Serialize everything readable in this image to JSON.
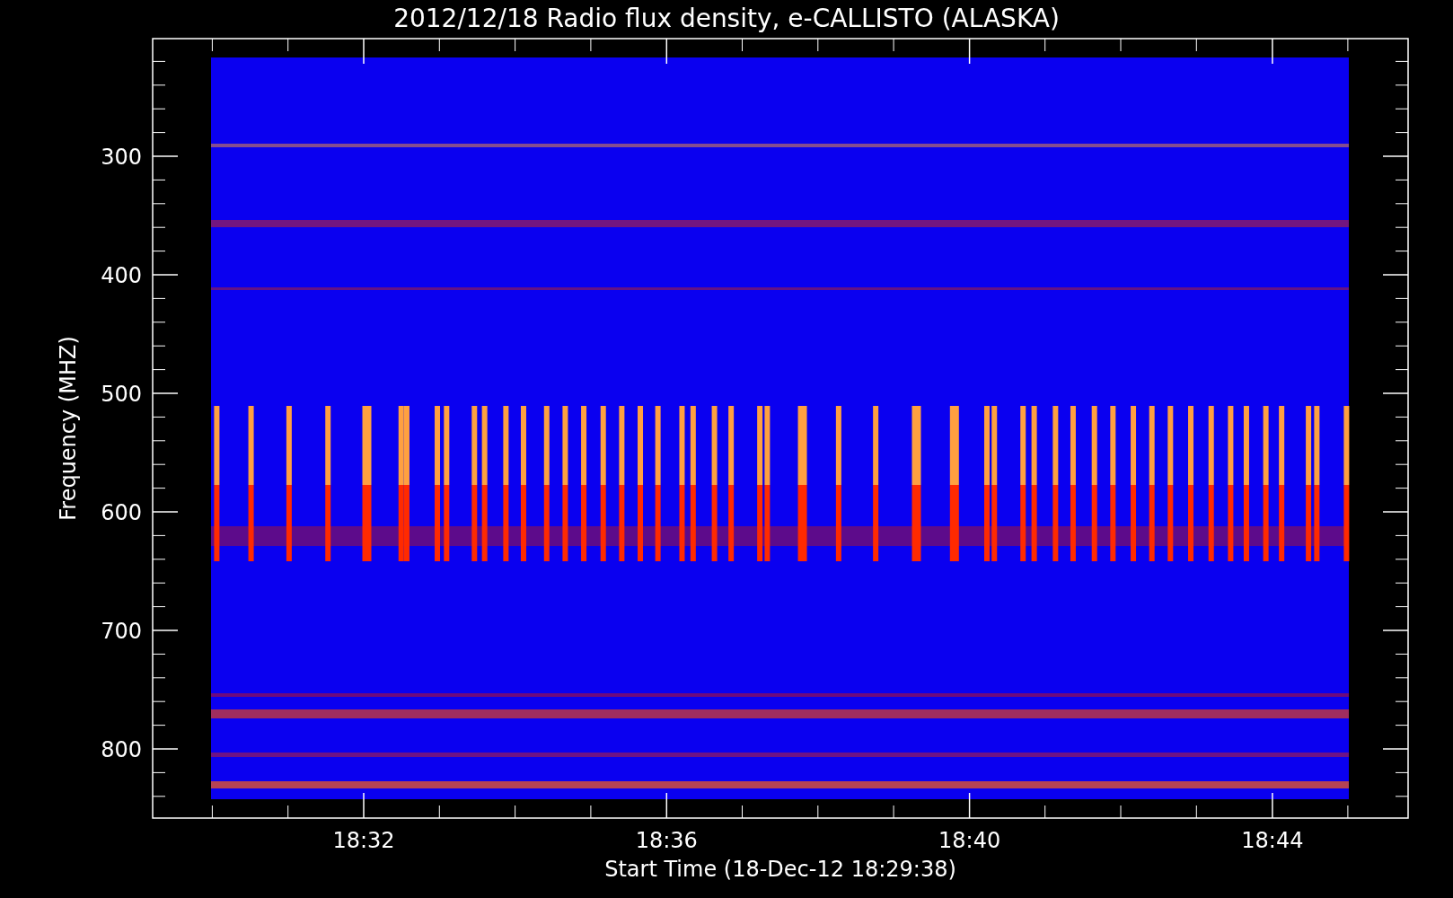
{
  "plot": {
    "title": "2012/12/18  Radio flux density, e-CALLISTO (ALASKA)",
    "y_axis": {
      "label": "Frequency (MHZ)",
      "ticks": [
        "300",
        "400",
        "500",
        "600",
        "700",
        "800"
      ]
    },
    "x_axis": {
      "label": "Start Time (18-Dec-12 18:29:38)",
      "ticks": [
        "18:32",
        "18:36",
        "18:40",
        "18:44"
      ]
    }
  }
}
